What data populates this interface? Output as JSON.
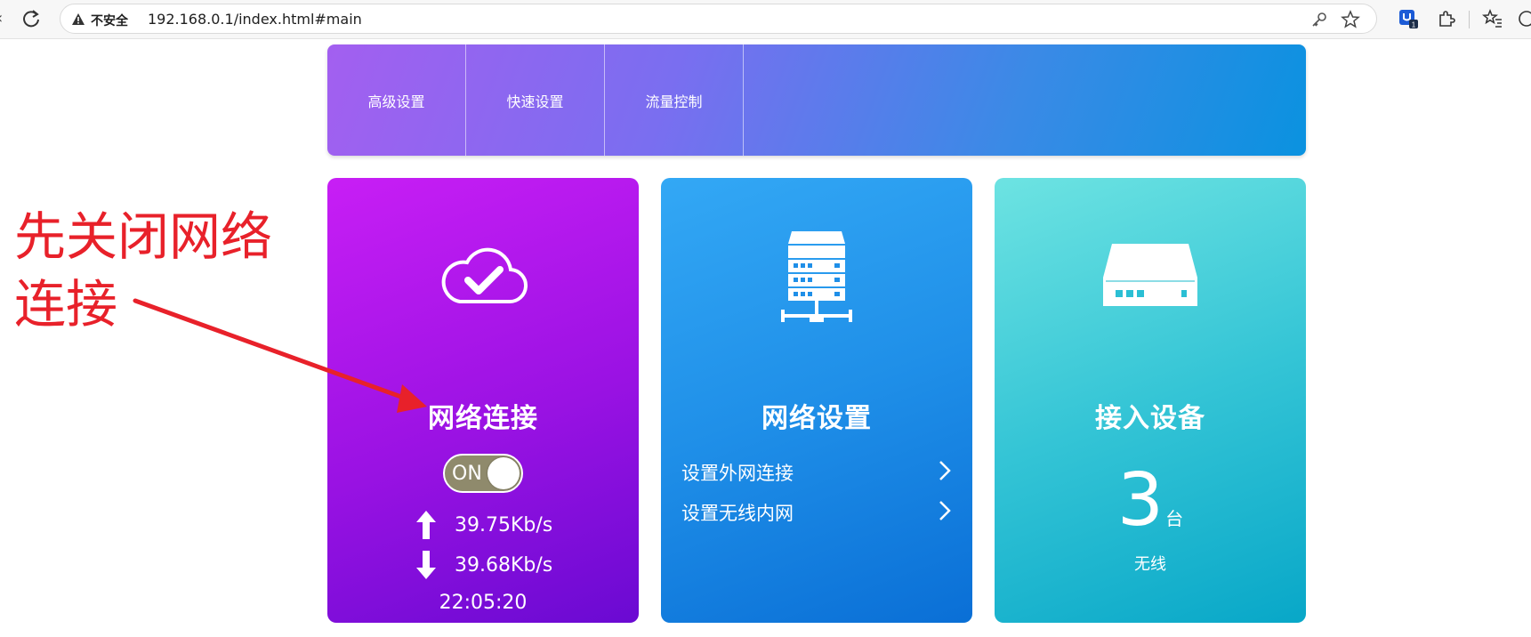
{
  "browser": {
    "security_label": "不安全",
    "url": "192.168.0.1/index.html#main",
    "extension_badge": "1"
  },
  "nav": {
    "items": [
      {
        "label": "高级设置"
      },
      {
        "label": "快速设置"
      },
      {
        "label": "流量控制"
      }
    ]
  },
  "cards": {
    "network": {
      "title": "网络连接",
      "toggle_label": "ON",
      "toggle_state": "on",
      "upload_rate": "39.75Kb/s",
      "download_rate": "39.68Kb/s",
      "uptime": "22:05:20"
    },
    "settings": {
      "title": "网络设置",
      "links": [
        {
          "label": "设置外网连接"
        },
        {
          "label": "设置无线内网"
        }
      ]
    },
    "devices": {
      "title": "接入设备",
      "count": "3",
      "unit": "台",
      "type": "无线"
    }
  },
  "annotation": {
    "text_line1": "先关闭网络",
    "text_line2": "连接",
    "color": "#e8212a"
  },
  "icons": {
    "network_card": "cloud-check-icon",
    "settings_card": "server-rack-icon",
    "devices_card": "router-icon"
  }
}
